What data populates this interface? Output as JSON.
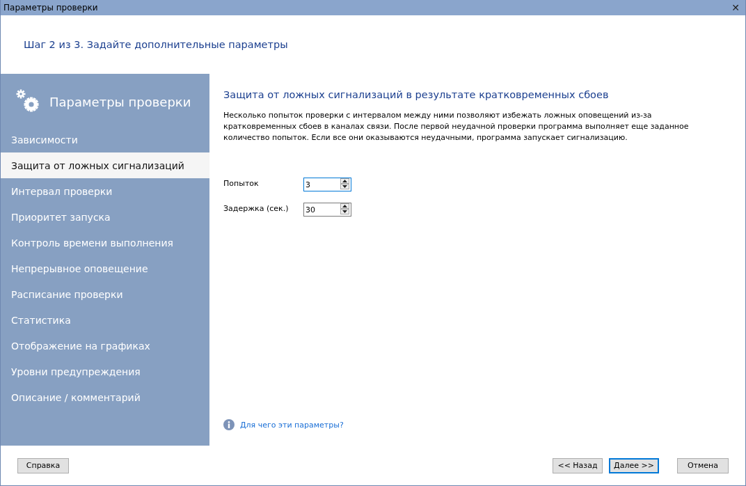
{
  "window": {
    "title": "Параметры проверки",
    "close": "✕"
  },
  "step_title": "Шаг 2 из 3. Задайте дополнительные параметры",
  "sidebar": {
    "title": "Параметры проверки",
    "items": [
      {
        "label": "Зависимости",
        "selected": false
      },
      {
        "label": "Защита от ложных сигнализаций",
        "selected": true
      },
      {
        "label": "Интервал проверки",
        "selected": false
      },
      {
        "label": "Приоритет запуска",
        "selected": false
      },
      {
        "label": "Контроль времени выполнения",
        "selected": false
      },
      {
        "label": "Непрерывное оповещение",
        "selected": false
      },
      {
        "label": "Расписание проверки",
        "selected": false
      },
      {
        "label": "Статистика",
        "selected": false
      },
      {
        "label": "Отображение на графиках",
        "selected": false
      },
      {
        "label": "Уровни предупреждения",
        "selected": false
      },
      {
        "label": "Описание / комментарий",
        "selected": false
      }
    ]
  },
  "content": {
    "heading": "Защита от ложных сигнализаций в результате кратковременных сбоев",
    "description": "Несколько попыток проверки с интервалом между ними позволяют избежать ложных оповещений из-за кратковременных сбоев в каналах связи. После первой неудачной проверки программа выполняет еще заданное количество попыток. Если все они оказываются неудачными, программа запускает сигнализацию.",
    "fields": [
      {
        "label": "Попыток",
        "value": "3",
        "focused": true
      },
      {
        "label": "Задержка (сек.)",
        "value": "30",
        "focused": false
      }
    ],
    "help_link": "Для чего эти параметры?"
  },
  "buttons": [
    {
      "label": "Справка",
      "kind": "help",
      "default": false
    },
    {
      "label": "<< Назад",
      "kind": "nav",
      "default": false
    },
    {
      "label": "Далее >>",
      "kind": "nav",
      "default": true
    },
    {
      "label": "Отмена",
      "kind": "cancel",
      "default": false
    }
  ]
}
